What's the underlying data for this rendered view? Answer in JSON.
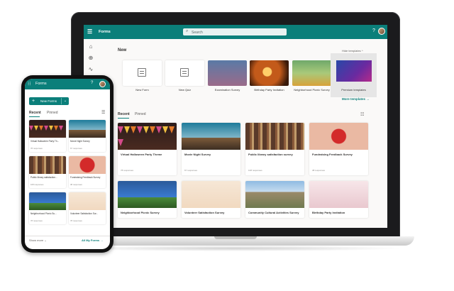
{
  "desktop": {
    "app_name": "Forms",
    "search_placeholder": "Search",
    "help_glyph": "?",
    "new_section_title": "New",
    "hide_templates_label": "Hide templates ^",
    "templates": [
      {
        "label": "New Form"
      },
      {
        "label": "New Quiz"
      },
      {
        "label": "Examination Survey"
      },
      {
        "label": "Birthday Party Invitation"
      },
      {
        "label": "Neighborhood Picnic Survey"
      },
      {
        "label": "Premium templates"
      }
    ],
    "more_templates_label": "More templates →",
    "tabs": {
      "recent": "Recent",
      "pinned": "Pinned"
    },
    "cards": [
      {
        "title": "Virtual Halloween Party Theme",
        "count": "78 responses"
      },
      {
        "title": "Movie Night Survey",
        "count": "67 responses"
      },
      {
        "title": "Public library satisfaction survey",
        "count": "108 responses"
      },
      {
        "title": "Fundraising Feedback Survey",
        "count": "38 responses"
      },
      {
        "title": "Neighborhood Picnic Survey",
        "count": ""
      },
      {
        "title": "Volunteer Satisfaction Survey",
        "count": ""
      },
      {
        "title": "Community Cultural Activities Survey",
        "count": ""
      },
      {
        "title": "Birthday Party Invitation",
        "count": ""
      }
    ]
  },
  "mobile": {
    "app_name": "Forms",
    "help_glyph": "?",
    "new_button_label": "New Forms",
    "tabs": {
      "recent": "Recent",
      "pinned": "Pinned"
    },
    "cards": [
      {
        "title": "Virtual Halloween Party Th...",
        "count": "78 responses"
      },
      {
        "title": "Movie Night Survey",
        "count": "67 responses"
      },
      {
        "title": "Public library satisfaction...",
        "count": "108 responses"
      },
      {
        "title": "Fundraising Feedback Survey",
        "count": "38 responses"
      },
      {
        "title": "Neighborhood Picnic Su...",
        "count": "78 responses"
      },
      {
        "title": "Volunteer Satisfaction Sur...",
        "count": "78 responses"
      }
    ],
    "show_more_label": "Show more ⌄",
    "all_my_forms_label": "All My Forms →"
  },
  "colors": {
    "brand": "#0b7f7a",
    "background": "#faf9f8"
  }
}
